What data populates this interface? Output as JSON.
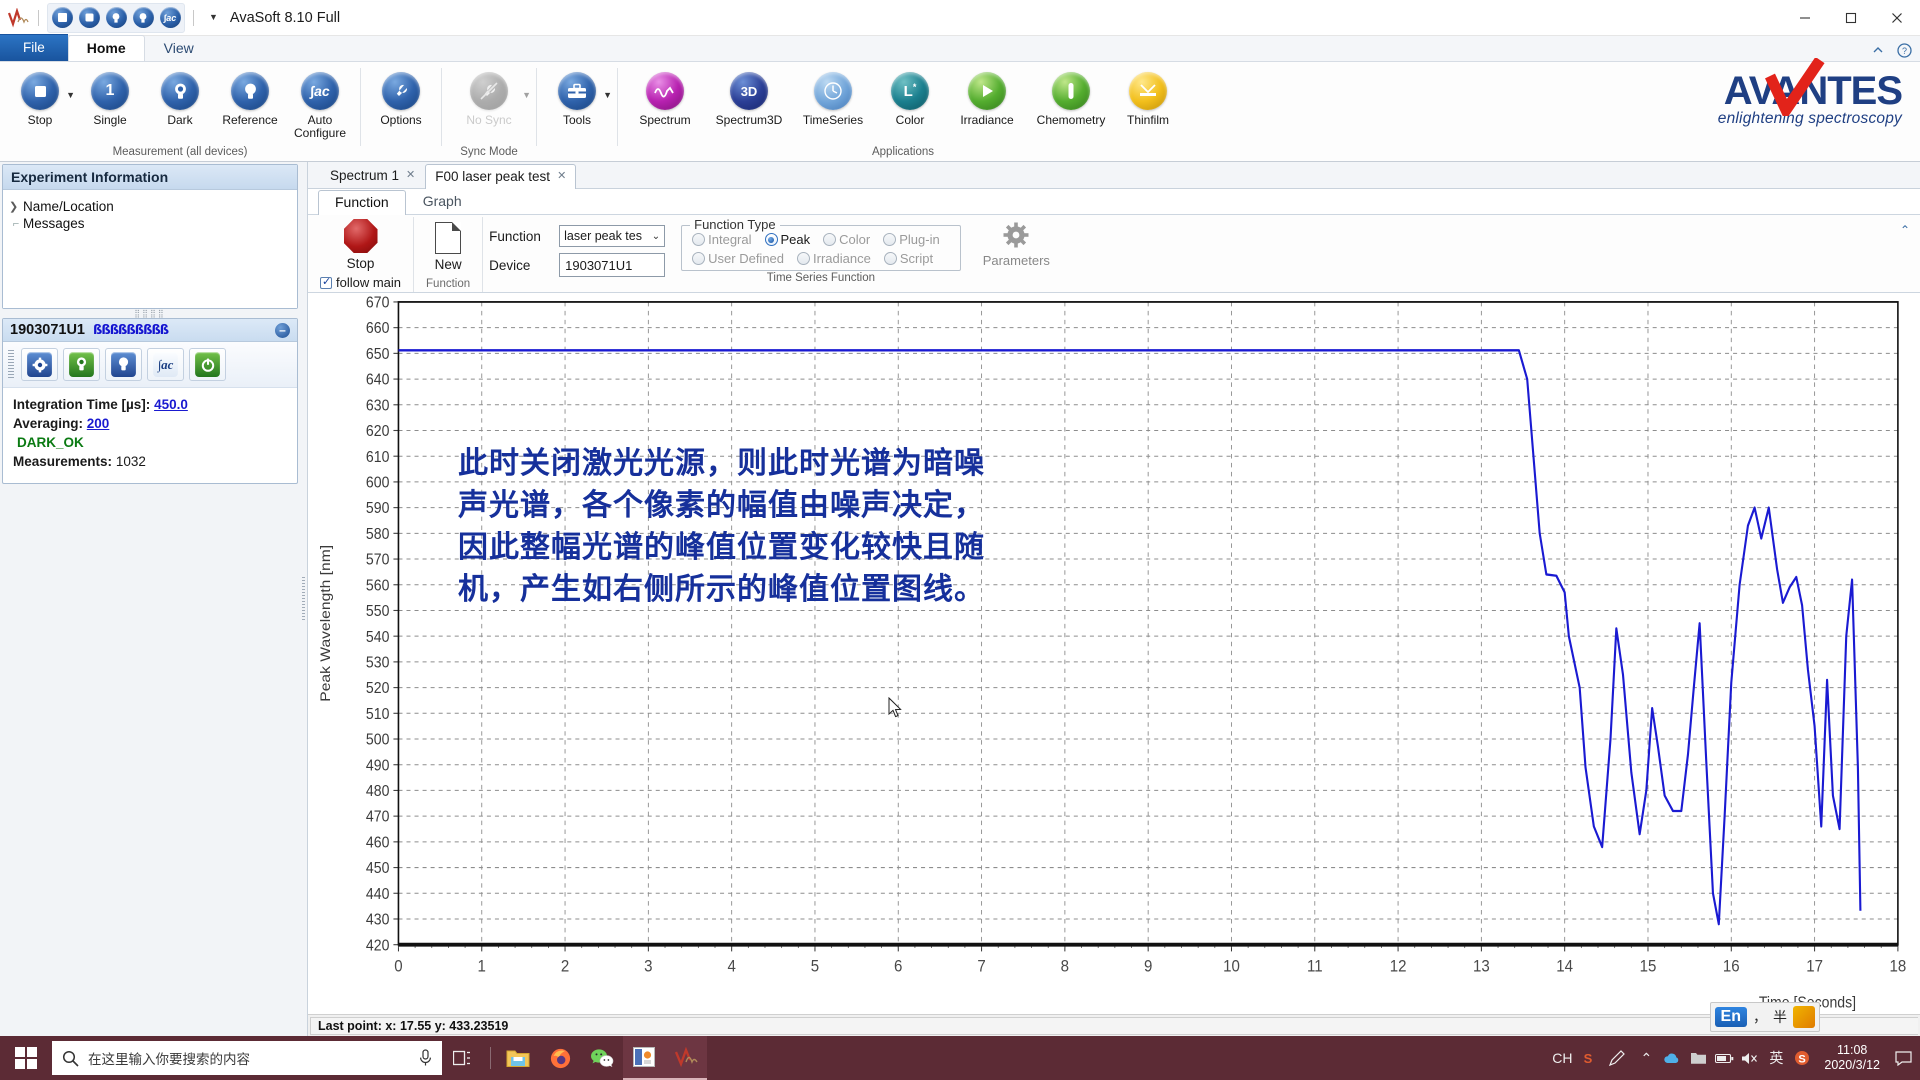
{
  "window": {
    "title": "AvaSoft 8.10 Full",
    "quick_access": [
      "measure-icon",
      "stop-icon",
      "single-icon",
      "dark-icon",
      "reference-icon",
      "autoconfigure-icon"
    ],
    "controls": {
      "minimize": "minimize-icon",
      "maximize": "maximize-icon",
      "close": "close-icon"
    }
  },
  "ribbon": {
    "tabs": [
      {
        "label": "File",
        "kind": "file"
      },
      {
        "label": "Home",
        "kind": "active"
      },
      {
        "label": "View",
        "kind": "inactive"
      }
    ],
    "help_icons": [
      "minimize-ribbon-icon",
      "help-icon"
    ],
    "groups": [
      {
        "label": "Measurement (all devices)",
        "items": [
          {
            "label": "Stop",
            "icon": "stop-icon",
            "caret": true,
            "disabled": false
          },
          {
            "label": "Single",
            "icon": "single-icon",
            "caret": false,
            "disabled": false
          },
          {
            "label": "Dark",
            "icon": "dark-icon",
            "caret": false,
            "disabled": false
          },
          {
            "label": "Reference",
            "icon": "reference-icon",
            "caret": false,
            "disabled": false
          },
          {
            "label": "Auto Configure",
            "icon": "auto-configure-icon",
            "caret": false,
            "disabled": false
          }
        ]
      },
      {
        "label": "",
        "items": [
          {
            "label": "Options",
            "icon": "options-icon",
            "caret": false,
            "disabled": false
          }
        ]
      },
      {
        "label": "Sync Mode",
        "items": [
          {
            "label": "No Sync",
            "icon": "no-sync-icon",
            "caret": true,
            "disabled": true
          }
        ]
      },
      {
        "label": "",
        "items": [
          {
            "label": "Tools",
            "icon": "tools-icon",
            "caret": true,
            "disabled": false
          }
        ]
      },
      {
        "label": "Applications",
        "items": [
          {
            "label": "Spectrum",
            "icon": "spectrum-icon",
            "caret": false,
            "disabled": false
          },
          {
            "label": "Spectrum3D",
            "icon": "spectrum3d-icon",
            "caret": false,
            "disabled": false
          },
          {
            "label": "TimeSeries",
            "icon": "timeseries-icon",
            "caret": false,
            "disabled": false
          },
          {
            "label": "Color",
            "icon": "color-icon",
            "caret": false,
            "disabled": false
          },
          {
            "label": "Irradiance",
            "icon": "irradiance-icon",
            "caret": false,
            "disabled": false
          },
          {
            "label": "Chemometry",
            "icon": "chemometry-icon",
            "caret": false,
            "disabled": false
          },
          {
            "label": "Thinfilm",
            "icon": "thinfilm-icon",
            "caret": false,
            "disabled": false
          }
        ]
      }
    ],
    "brand": {
      "name": "AVANTES",
      "tagline": "enlightening spectroscopy"
    }
  },
  "sidebar": {
    "experiment": {
      "title": "Experiment Information",
      "tree": [
        {
          "label": "Name/Location",
          "marker": ">"
        },
        {
          "label": "Messages",
          "marker": "dash"
        }
      ]
    },
    "device": {
      "name": "1903071U1",
      "signal": "ßßßßßßßßß",
      "collapse": "–",
      "toolbar": [
        {
          "icon": "device-settings-icon"
        },
        {
          "icon": "dark-lamp-icon"
        },
        {
          "icon": "reference-lamp-icon"
        },
        {
          "icon": "jac-icon"
        },
        {
          "icon": "power-icon"
        }
      ],
      "integration_label": "Integration Time  [µs]:",
      "integration_value": "450.0",
      "averaging_label": "Averaging:",
      "averaging_value": "200",
      "dark_status": "DARK_OK",
      "measurements_label": "Measurements:",
      "measurements_value": "1032"
    }
  },
  "work": {
    "doc_tabs": [
      {
        "label": "Spectrum 1",
        "active": false,
        "close": "✕"
      },
      {
        "label": "F00 laser peak test",
        "active": true,
        "close": "✕"
      }
    ],
    "sub_tabs": [
      {
        "label": "Function",
        "active": true
      },
      {
        "label": "Graph",
        "active": false
      }
    ],
    "toolbar": {
      "stop_label": "Stop",
      "follow_main_label": "follow main",
      "function_group_caption": "Function",
      "new_label": "New",
      "function_field_label": "Function",
      "function_field_value": "laser peak tes",
      "device_field_label": "Device",
      "device_field_value": "1903071U1",
      "function_type_legend": "Function Type",
      "function_type_options": [
        {
          "label": "Integral",
          "selected": false,
          "disabled": true
        },
        {
          "label": "Peak",
          "selected": true,
          "disabled": false
        },
        {
          "label": "Color",
          "selected": false,
          "disabled": true
        },
        {
          "label": "Plug-in",
          "selected": false,
          "disabled": true
        },
        {
          "label": "User Defined",
          "selected": false,
          "disabled": true
        },
        {
          "label": "Irradiance",
          "selected": false,
          "disabled": true
        },
        {
          "label": "Script",
          "selected": false,
          "disabled": true
        }
      ],
      "time_series_caption": "Time Series Function",
      "parameters_label": "Parameters"
    }
  },
  "chart_data": {
    "type": "line",
    "title": "",
    "xlabel": "Time [Seconds]",
    "ylabel": "Peak Wavelength [nm]",
    "xlim": [
      0,
      18
    ],
    "ylim": [
      420,
      670
    ],
    "xticks": [
      0,
      1,
      2,
      3,
      4,
      5,
      6,
      7,
      8,
      9,
      10,
      11,
      12,
      13,
      14,
      15,
      16,
      17,
      18
    ],
    "yticks": [
      420,
      430,
      440,
      450,
      460,
      470,
      480,
      490,
      500,
      510,
      520,
      530,
      540,
      550,
      560,
      570,
      580,
      590,
      600,
      610,
      620,
      630,
      640,
      650,
      660,
      670
    ],
    "grid": true,
    "legend": "none",
    "series": [
      {
        "name": "Peak Wavelength",
        "color": "#1a1ad2",
        "x": [
          0.0,
          1.0,
          2.0,
          3.0,
          4.0,
          5.0,
          6.0,
          7.0,
          8.0,
          9.0,
          10.0,
          11.0,
          12.0,
          13.0,
          13.45,
          13.55,
          13.62,
          13.7,
          13.78,
          13.9,
          14.0,
          14.05,
          14.18,
          14.25,
          14.35,
          14.45,
          14.55,
          14.62,
          14.7,
          14.8,
          14.9,
          14.98,
          15.05,
          15.12,
          15.2,
          15.3,
          15.4,
          15.48,
          15.55,
          15.62,
          15.7,
          15.78,
          15.85,
          15.92,
          16.0,
          16.1,
          16.2,
          16.28,
          16.36,
          16.45,
          16.55,
          16.62,
          16.7,
          16.78,
          16.85,
          16.92,
          17.0,
          17.08,
          17.15,
          17.22,
          17.3,
          17.38,
          17.45,
          17.52,
          17.55
        ],
        "y": [
          651.2,
          651.2,
          651.2,
          651.2,
          651.2,
          651.2,
          651.2,
          651.2,
          651.2,
          651.2,
          651.2,
          651.2,
          651.2,
          651.2,
          651.2,
          640.0,
          612.0,
          580.0,
          564.0,
          563.5,
          557.0,
          540.0,
          520.0,
          489.0,
          466.0,
          458.0,
          500.0,
          543.0,
          525.0,
          487.0,
          463.0,
          480.0,
          512.0,
          497.0,
          478.0,
          472.0,
          472.0,
          494.0,
          520.0,
          545.0,
          491.0,
          440.0,
          428.0,
          470.0,
          522.0,
          560.0,
          583.0,
          590.0,
          578.0,
          590.0,
          566.0,
          553.0,
          559.0,
          563.0,
          552.0,
          527.0,
          505.0,
          466.0,
          523.0,
          478.0,
          465.0,
          540.0,
          562.0,
          489.0,
          433.2
        ]
      }
    ],
    "annotation": {
      "color": "#16309b",
      "lines": [
        "此时关闭激光光源，则此时光谱为暗噪",
        "声光谱，各个像素的幅值由噪声决定，",
        "因此整幅光谱的峰值位置变化较快且随",
        "机，产生如右侧所示的峰值位置图线。"
      ]
    }
  },
  "statusbar": {
    "text": "Last point: x: 17.55 y: 433.23519"
  },
  "taskbar": {
    "start_icon": "windows-start-icon",
    "search_placeholder": "在这里输入你要搜索的内容",
    "search_icon": "search-icon",
    "mic_icon": "microphone-icon",
    "taskview_icon": "task-view-icon",
    "apps": [
      {
        "icon": "file-explorer-icon",
        "running": false
      },
      {
        "icon": "firefox-icon",
        "running": false
      },
      {
        "icon": "wechat-icon",
        "running": false
      },
      {
        "icon": "image-viewer-icon",
        "running": true
      },
      {
        "icon": "avasoft-icon",
        "running": true
      }
    ],
    "tray": [
      "ch-icon",
      "sogou-icon",
      "pen-icon",
      "chevron-up-icon",
      "cloud-icon",
      "folder-tray-icon",
      "battery-icon",
      "volume-icon",
      "ime-cn-icon",
      "s-icon"
    ],
    "clock_time": "11:08",
    "clock_date": "2020/3/12",
    "notification_icon": "action-center-icon",
    "ime": {
      "lang": "En",
      "items": [
        "，",
        "半",
        "ime-logo"
      ]
    }
  }
}
